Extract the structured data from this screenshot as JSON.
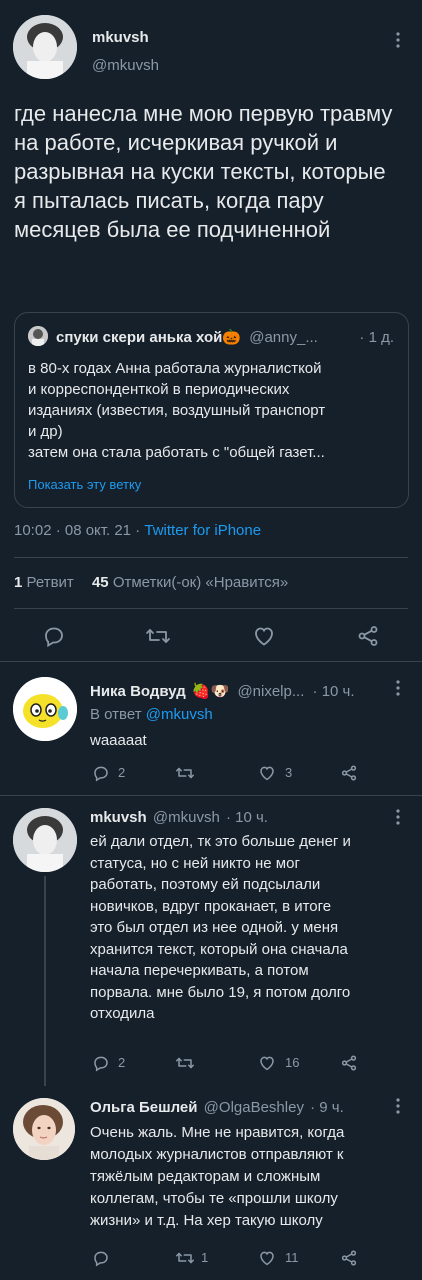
{
  "main": {
    "author_name": "mkuvsh",
    "author_handle": "@mkuvsh",
    "text": "где нанесла мне мою первую травму на работе, исчеркивая ручкой и разрывная на куски тексты, которые я пыталась писать, когда пару месяцев была ее подчиненной",
    "quote": {
      "name": "спуки скери анька хой🎃",
      "handle": "@anny_...",
      "time": "· 1 д.",
      "lines": [
        "в 80-х годах Анна работала журналисткой",
        "и корреспонденткой в периодических",
        "изданиях (известия, воздушный транспорт",
        "и др)",
        "затем она стала работать с \"общей газет..."
      ],
      "show_thread": "Показать эту ветку"
    },
    "timestamp": "10:02 · 08 окт. 21 · ",
    "source": "Twitter for iPhone",
    "retweets_count": "1",
    "retweets_label": "Ретвит",
    "likes_count": "45",
    "likes_label": "Отметки(-ок) «Нравится»"
  },
  "replies": [
    {
      "name": "Ника Водвуд",
      "emoji": "🍓🐶",
      "handle": "@nixelp...",
      "time": "· 10 ч.",
      "reply_to_label": "В ответ ",
      "reply_to_handle": "@mkuvsh",
      "text": "waaaaat",
      "reply_count": "2",
      "retweet_count": "",
      "like_count": "3"
    },
    {
      "name": "mkuvsh",
      "handle": "@mkuvsh",
      "time": "· 10 ч.",
      "lines": [
        "ей дали отдел, тк это больше денег и",
        "статуса, но с ней никто не мог",
        "работать, поэтому ей подсылали",
        "новичков, вдруг проканает, в итоге",
        "это был отдел из нее одной. у меня",
        "хранится текст, который она сначала",
        "начала перечеркивать, а потом",
        "порвала. мне было 19, я потом долго",
        "отходила"
      ],
      "reply_count": "2",
      "retweet_count": "",
      "like_count": "16"
    },
    {
      "name": "Ольга Бешлей",
      "handle": "@OlgaBeshley",
      "time": "· 9 ч.",
      "lines": [
        "Очень жаль. Мне не нравится, когда",
        "молодых журналистов отправляют к",
        "тяжёлым редакторам и сложным",
        "коллегам, чтобы те «прошли школу",
        "жизни» и т.д. На хер такую школу"
      ],
      "reply_count": "",
      "retweet_count": "1",
      "like_count": "11"
    }
  ],
  "colors": {
    "background": "#15202b",
    "text": "#e7e9ea",
    "muted": "#8b98a5",
    "accent": "#1d9bf0",
    "divider": "#38444d"
  }
}
